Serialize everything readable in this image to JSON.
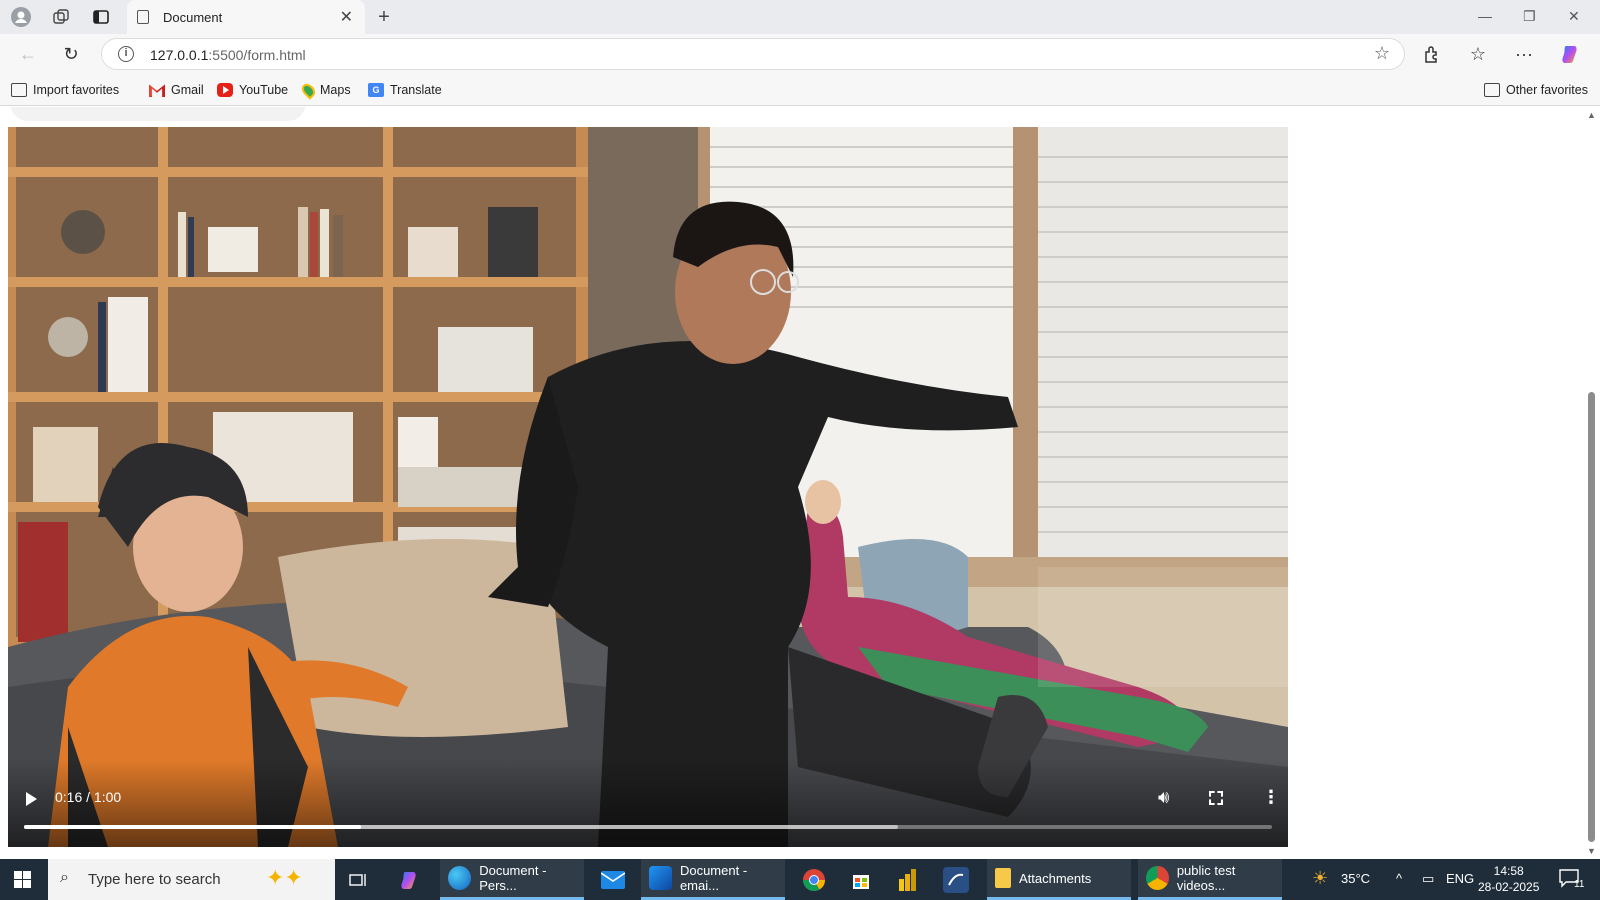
{
  "browser": {
    "tab_title": "Document",
    "url_host": "127.0.0.1",
    "url_path": ":5500/form.html"
  },
  "favorites": [
    {
      "label": "Import favorites",
      "icon": "import-icon"
    },
    {
      "label": "Gmail",
      "icon": "gmail-icon"
    },
    {
      "label": "YouTube",
      "icon": "youtube-icon"
    },
    {
      "label": "Maps",
      "icon": "maps-icon"
    },
    {
      "label": "Translate",
      "icon": "translate-icon"
    }
  ],
  "other_favorites": "Other favorites",
  "video": {
    "current_time": "0:16",
    "duration": "1:00",
    "time_text": "0:16 / 1:00",
    "played_fraction": 0.27,
    "buffered_fraction": 0.7
  },
  "taskbar": {
    "search_placeholder": "Type here to search",
    "apps": [
      {
        "label": "Document - Pers...",
        "icon": "edge-icon"
      },
      {
        "label": "Document - emai...",
        "icon": "vscode-icon"
      },
      {
        "label": "Attachments",
        "icon": "folder-icon"
      },
      {
        "label": "public test videos...",
        "icon": "chrome-icon"
      }
    ],
    "temperature": "35°C",
    "language": "ENG",
    "time": "14:58",
    "date": "28-02-2025",
    "notifications": "11"
  },
  "colors": {
    "taskbar_bg": "#1f2d3a",
    "active_indicator": "#76b9ed",
    "browser_chrome": "#f7f7f7"
  }
}
